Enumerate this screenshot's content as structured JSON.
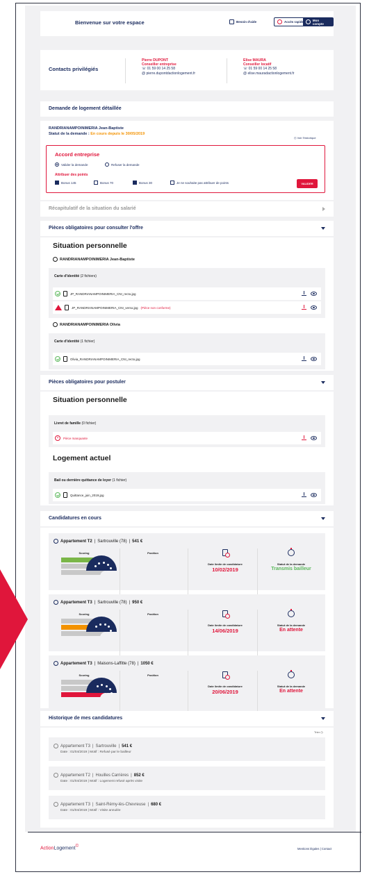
{
  "header": {
    "title": "Bienvenue sur votre espace",
    "help_label": "Besoin d'aide",
    "quick_access_label": "Accès rapides",
    "account_label": "Mon compte"
  },
  "contacts": {
    "label": "Contacts privilégiés",
    "items": [
      {
        "name": "Pierre DUPONT",
        "role": "Conseiller entreprise",
        "phone": "01 59 00 14 25 58",
        "email": "pierre.dupontdactionlogement.fr"
      },
      {
        "name": "Elise MAURA",
        "role": "Conseiller locatif",
        "phone": "01 59 00 14 25 58",
        "email": "elise.mauradactionlogement.fr"
      }
    ]
  },
  "demande": {
    "section_title": "Demande de logement détaillée",
    "applicant": "RANDRIANAMPOINIMERIA Jean-Baptiste",
    "status_prefix": "Statut de la demande : ",
    "status_value": "En cours depuis le 30/05/2019",
    "history_link": "Voir l'historique"
  },
  "accord": {
    "title": "Accord entreprise",
    "radio_validate": "Valider la demande",
    "radio_refuse": "Refuser la demande",
    "points_title": "Attribuer des points",
    "checkboxes": [
      "Bonus 145",
      "Bonus 70",
      "Bonus 30",
      "Je ne souhaite pas attribuer de points"
    ],
    "checked": [
      true,
      false,
      true,
      false
    ],
    "validate_button": "VALIDER"
  },
  "sections": {
    "recap": "Récapitulatif de la situation du salarié",
    "pieces_offre": "Pièces obligatoires pour consulter l'offre",
    "pieces_postuler": "Pièces obligatoires pour postuler",
    "candidatures": "Candidatures en cours",
    "historique": "Historique de mes candidatures"
  },
  "situation1": {
    "heading": "Situation personnelle",
    "person1": "RANDRIANAMPOINIMERIA Jean-Baptiste",
    "doc1_label": "Carte d'identité",
    "doc1_count": "(2 fichiers)",
    "file1": "JP_RANDRIANAMPOINIMERIA_CNI_recto.jpg",
    "file2": "JP_RANDRIANAMPOINIMERIA_CNI_verso.jpg",
    "file2_error": "(Pièce non conforme)",
    "person2": "RANDRIANAMPOINIMERIA Olivia",
    "doc2_label": "Carte d'identité",
    "doc2_count": "(1 fichier)",
    "file3": "Olivia_RANDRIANAMPOINIMERIA_CNI_recto.jpg"
  },
  "situation2": {
    "heading": "Situation personnelle",
    "doc_label": "Livret de famille",
    "doc_count": "(0 fichier)",
    "missing": "Pièce manquante"
  },
  "logement": {
    "heading": "Logement actuel",
    "doc_label": "Bail ou dernière quittance de loyer",
    "doc_count": "(1 fichier)",
    "file": "Quittance_juin_2019.jpg"
  },
  "candidatures": {
    "scoring_label": "Scoring",
    "position_label": "Position",
    "date_label": "Date limite de candidature",
    "status_label": "Statut de la demande",
    "items": [
      {
        "type": "Appartement T2",
        "city": "Sartrouville (78)",
        "price": "541 €",
        "date": "10/02/2019",
        "status": "Transmis bailleur",
        "status_color": "#5cb85c",
        "score_color": "#7ab648",
        "score_level": 3,
        "position": 0.2
      },
      {
        "type": "Appartement T3",
        "city": "Sartrouville (78)",
        "price": "950 €",
        "date": "14/06/2019",
        "status": "En attente",
        "status_color": "#e0163b",
        "score_color": "#f39200",
        "score_level": 2,
        "position": 0.5
      },
      {
        "type": "Appartement T3",
        "city": "Maisons-Laffitte (78)",
        "price": "1050 €",
        "date": "20/06/2019",
        "status": "En attente",
        "status_color": "#e0163b",
        "score_color": "#e0163b",
        "score_level": 1,
        "position": 0.8
      }
    ]
  },
  "historique": {
    "sort_label": "Trier",
    "date_prefix": "Date : ",
    "motif_prefix": "Motif : ",
    "items": [
      {
        "type": "Appartement T3",
        "city": "Sartrouville",
        "price": "541 €",
        "date": "01/04/2019",
        "motif": "Refusé par le bailleur"
      },
      {
        "type": "Appartement T2",
        "city": "Houilles Carrières",
        "price": "852 €",
        "date": "01/04/2019",
        "motif": "Logement refusé après visite"
      },
      {
        "type": "Appartement T3",
        "city": "Saint-Rémy-lès-Chevreuse",
        "price": "680 €",
        "date": "01/04/2019",
        "motif": "Visite annulée"
      }
    ]
  },
  "footer": {
    "logo_action": "Action",
    "logo_logement": "Logement",
    "legal": "Mentions légales  |  Contact"
  }
}
